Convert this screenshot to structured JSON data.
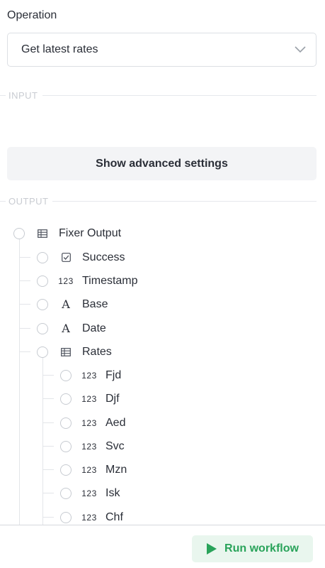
{
  "operation": {
    "label": "Operation",
    "selected": "Get latest rates",
    "chevron_icon": "chevron-down-icon"
  },
  "input_section": {
    "title": "INPUT"
  },
  "advanced": {
    "label": "Show advanced settings"
  },
  "output_section": {
    "title": "OUTPUT"
  },
  "tree": {
    "root": {
      "label": "Fixer Output",
      "type": "object"
    },
    "children": [
      {
        "label": "Success",
        "type": "boolean"
      },
      {
        "label": "Timestamp",
        "type": "number",
        "type_text": "123"
      },
      {
        "label": "Base",
        "type": "text",
        "type_text": "A"
      },
      {
        "label": "Date",
        "type": "text",
        "type_text": "A"
      },
      {
        "label": "Rates",
        "type": "object"
      }
    ],
    "rates": [
      {
        "label": "Fjd",
        "type_text": "123"
      },
      {
        "label": "Djf",
        "type_text": "123"
      },
      {
        "label": "Aed",
        "type_text": "123"
      },
      {
        "label": "Svc",
        "type_text": "123"
      },
      {
        "label": "Mzn",
        "type_text": "123"
      },
      {
        "label": "Isk",
        "type_text": "123"
      },
      {
        "label": "Chf",
        "type_text": "123"
      }
    ]
  },
  "footer": {
    "run_label": "Run workflow",
    "run_icon": "play-icon",
    "accent": "#29a35a"
  }
}
